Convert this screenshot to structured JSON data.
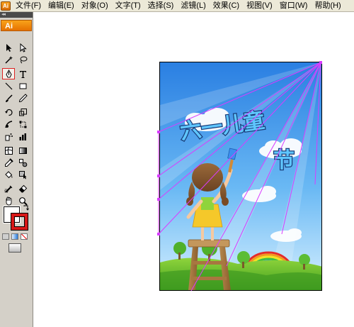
{
  "menu": {
    "items": [
      "文件(F)",
      "编辑(E)",
      "对象(O)",
      "文字(T)",
      "选择(S)",
      "滤镜(L)",
      "效果(C)",
      "视图(V)",
      "窗口(W)",
      "帮助(H)"
    ]
  },
  "tools_panel": {
    "grip": "◂◂",
    "logo": "Ai",
    "tools": [
      [
        "selection-tool",
        "direct-selection-tool"
      ],
      [
        "magic-wand-tool",
        "lasso-tool"
      ],
      [
        "pen-tool",
        "type-tool"
      ],
      [
        "line-segment-tool",
        "rectangle-tool"
      ],
      [
        "paintbrush-tool",
        "pencil-tool"
      ],
      [
        "rotate-tool",
        "scale-tool"
      ],
      [
        "warp-tool",
        "free-transform-tool"
      ],
      [
        "symbol-sprayer-tool",
        "column-graph-tool"
      ],
      [
        "mesh-tool",
        "gradient-tool"
      ],
      [
        "eyedropper-tool",
        "blend-tool"
      ],
      [
        "live-paint-bucket-tool",
        "live-paint-selection-tool"
      ],
      [
        "slice-tool",
        "eraser-tool"
      ],
      [
        "hand-tool",
        "zoom-tool"
      ]
    ],
    "active_tool": "pen-tool",
    "fill_color": "#ffffff",
    "stroke_color": "#d81818"
  },
  "artwork": {
    "title_line1": "六一儿童",
    "title_line2": "节",
    "sky_top": "#2f86e6",
    "sky_bottom": "#bfe6ff",
    "grass": "#5cb82c",
    "guide_color": "#d93cff"
  }
}
